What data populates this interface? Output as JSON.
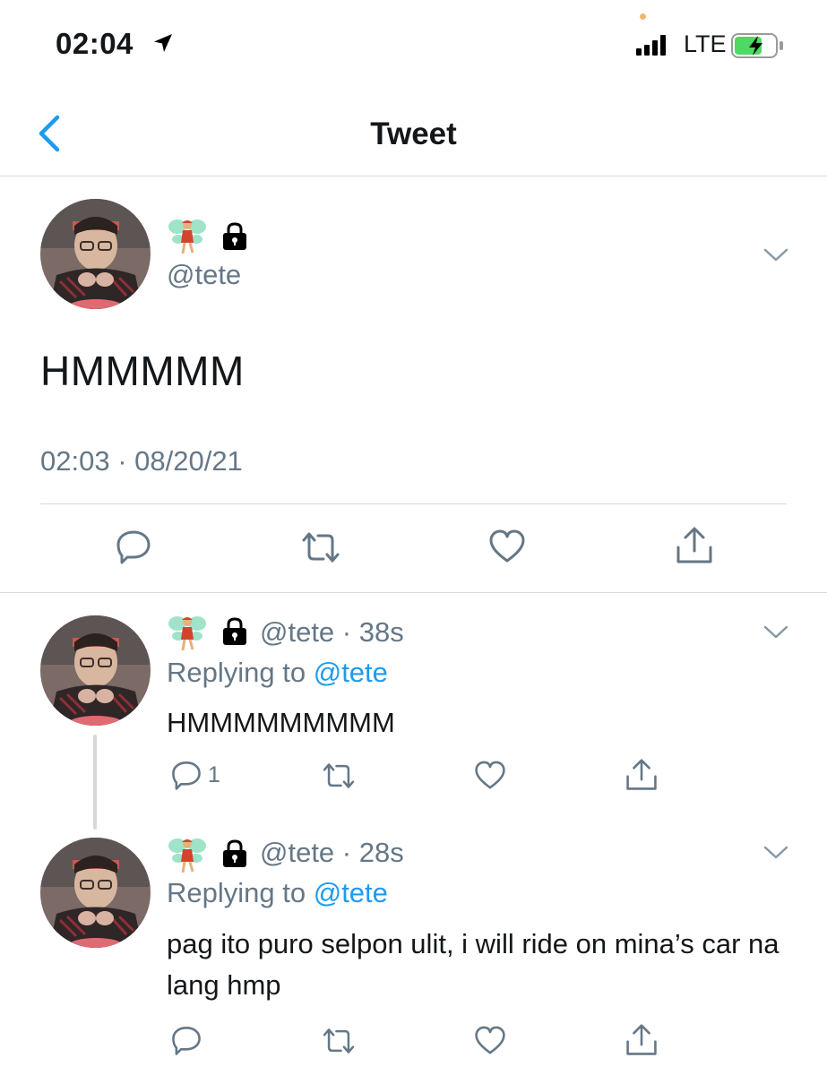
{
  "status_bar": {
    "time": "02:04",
    "network": "LTE"
  },
  "nav": {
    "title": "Tweet",
    "back_icon": "chevron-left-icon"
  },
  "colors": {
    "accent": "#1d9bf0",
    "muted": "#657786",
    "divider": "#d6d9db",
    "battery": "#4cd964"
  },
  "main_tweet": {
    "handle": "@tete",
    "emojis": [
      "fairy-emoji",
      "lock-icon"
    ],
    "text": "HMMMMM",
    "timestamp": "02:03 · 08/20/21",
    "actions": [
      "reply-icon",
      "retweet-icon",
      "like-icon",
      "share-icon"
    ]
  },
  "replies": [
    {
      "handle": "@tete",
      "age": "38s",
      "replying_prefix": "Replying to ",
      "replying_to": "@tete",
      "text": "HMMMMMMMMM",
      "reply_count": "1"
    },
    {
      "handle": "@tete",
      "age": "28s",
      "replying_prefix": "Replying to ",
      "replying_to": "@tete",
      "text": "pag ito puro selpon ulit, i will ride on mina’s car na lang hmp",
      "reply_count": ""
    }
  ]
}
